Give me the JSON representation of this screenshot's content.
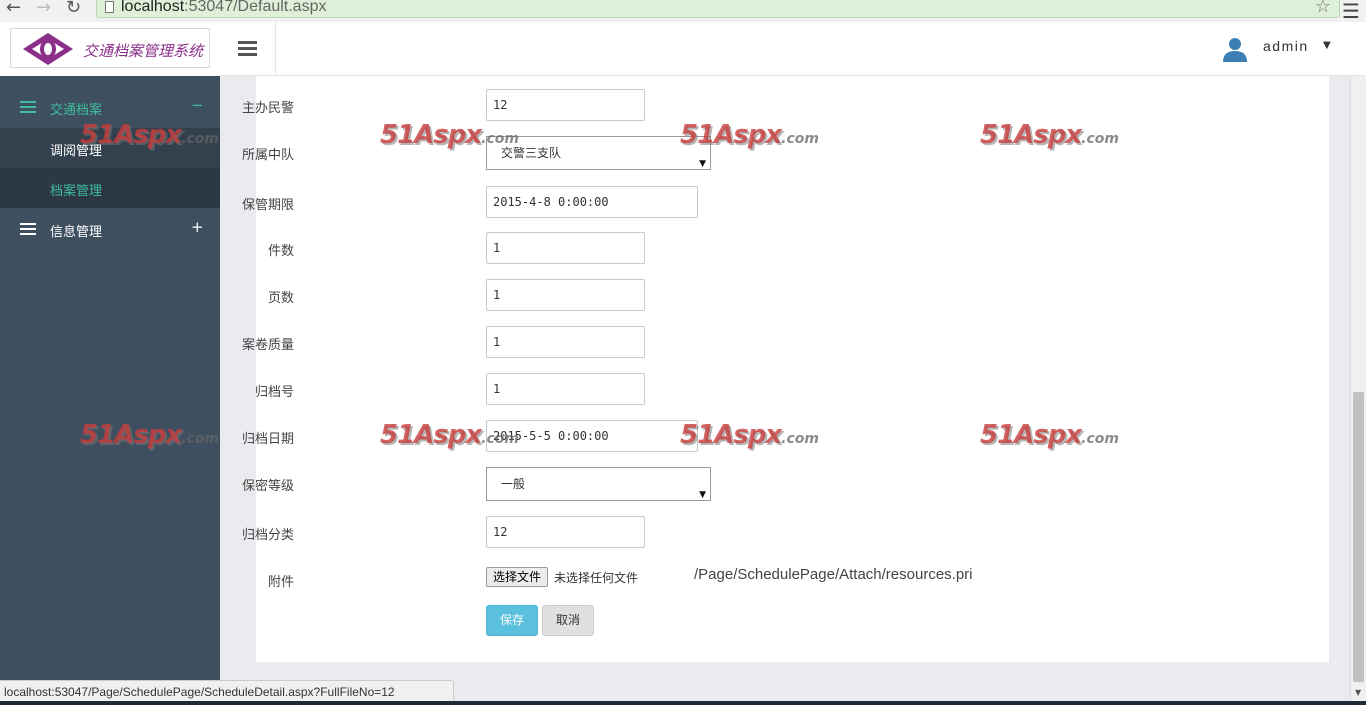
{
  "browser": {
    "url_host": "localhost",
    "url_rest": ":53047/Default.aspx",
    "back_icon": "back-arrow-icon",
    "forward_icon": "forward-arrow-icon",
    "reload_icon": "reload-icon",
    "bookmark_icon": "star-icon",
    "menu_icon": "menu-icon"
  },
  "header": {
    "logo_text": "交通档案管理系统",
    "user_name": "admin",
    "colors": {
      "logo": "#8b2f8a",
      "accent": "#3fbc9d"
    }
  },
  "sidebar": {
    "groups": [
      {
        "label": "交通档案",
        "toggle": "−",
        "expanded": true,
        "items": [
          {
            "label": "调阅管理"
          },
          {
            "label": "档案管理",
            "selected": true
          }
        ]
      },
      {
        "label": "信息管理",
        "toggle": "+",
        "expanded": false,
        "items": []
      }
    ],
    "colors": {
      "background": "#3e4f60",
      "submenu": "#33414f",
      "active_text": "#3fbc9d"
    }
  },
  "form": {
    "fields": [
      {
        "label": "主办民警",
        "value": "12",
        "type": "text"
      },
      {
        "label": "所属中队",
        "value": "交警三支队",
        "type": "select"
      },
      {
        "label": "保管期限",
        "value": "2015-4-8 0:00:00",
        "type": "text"
      },
      {
        "label": "件数",
        "value": "1",
        "type": "text"
      },
      {
        "label": "页数",
        "value": "1",
        "type": "text"
      },
      {
        "label": "案卷质量",
        "value": "1",
        "type": "text"
      },
      {
        "label": "归档号",
        "value": "1",
        "type": "text"
      },
      {
        "label": "归档日期",
        "value": "2015-5-5 0:00:00",
        "type": "text"
      },
      {
        "label": "保密等级",
        "value": "一般",
        "type": "select"
      },
      {
        "label": "归档分类",
        "value": "12",
        "type": "text"
      }
    ],
    "attachment": {
      "label": "附件",
      "button": "选择文件",
      "status": "未选择任何文件",
      "path": "/Page/SchedulePage/Attach/resources.pri"
    },
    "buttons": {
      "save": "保存",
      "cancel": "取消"
    }
  },
  "status_bar": {
    "text": "localhost:53047/Page/SchedulePage/ScheduleDetail.aspx?FullFileNo=12"
  },
  "watermark": {
    "main": "51Aspx",
    "suffix": ".com"
  }
}
